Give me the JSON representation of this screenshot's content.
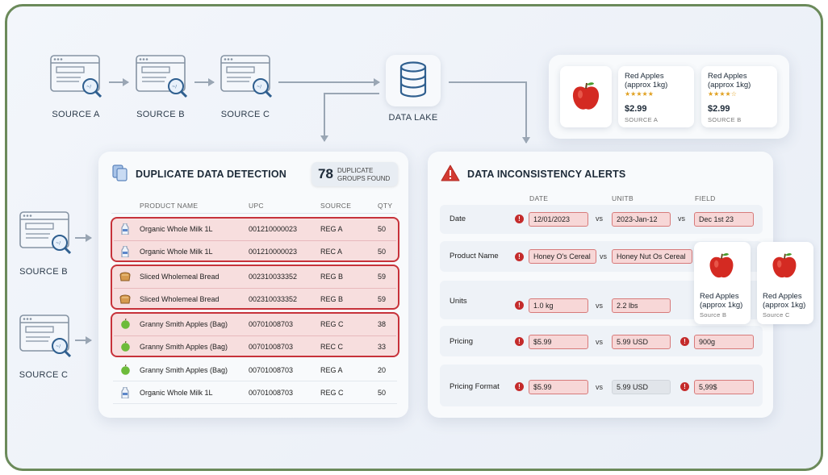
{
  "pipeline": {
    "sources_top": [
      "SOURCE A",
      "SOURCE B",
      "SOURCE C"
    ],
    "sources_left": [
      "SOURCE B",
      "SOURCE C"
    ],
    "data_lake_label": "DATA LAKE"
  },
  "product_panel": {
    "cards": [
      {
        "name_line1": "Red Apples",
        "name_line2": "(approx 1kg)",
        "stars": "★★★★★",
        "price": "$2.99",
        "source": "SOURCE A"
      },
      {
        "name_line1": "Red Apples",
        "name_line2": "(approx 1kg)",
        "stars": "★★★★☆",
        "price": "$2.99",
        "source": "SOURCE B"
      }
    ]
  },
  "floating_products": [
    {
      "name_line1": "Red Apples",
      "name_line2": "(approx 1kg)",
      "source": "Source B"
    },
    {
      "name_line1": "Red Apples",
      "name_line2": "(approx 1kg)",
      "source": "Source C"
    }
  ],
  "duplicate": {
    "title": "DUPLICATE DATA DETECTION",
    "count": "78",
    "count_label_1": "DUPLICATE",
    "count_label_2": "GROUPS FOUND",
    "columns": [
      "PRODUCT NAME",
      "UPC",
      "SOURCE",
      "QTY"
    ],
    "rows": [
      {
        "icon": "milk-icon",
        "name": "Organic Whole Milk 1L",
        "upc": "001210000023",
        "source": "REG A",
        "qty": "50"
      },
      {
        "icon": "milk-icon",
        "name": "Organic Whole Milk 1L",
        "upc": "001210000023",
        "source": "REC A",
        "qty": "50"
      },
      {
        "icon": "bread-icon",
        "name": "Sliced Wholemeal Bread",
        "upc": "002310033352",
        "source": "REG B",
        "qty": "59"
      },
      {
        "icon": "bread-icon",
        "name": "Sliced Wholemeal Bread",
        "upc": "002310033352",
        "source": "REG B",
        "qty": "59"
      },
      {
        "icon": "apple-icon",
        "name": "Granny Smith Apples (Bag)",
        "upc": "00701008703",
        "source": "REG C",
        "qty": "38"
      },
      {
        "icon": "apple-icon",
        "name": "Granny Smith Apples (Bag)",
        "upc": "00701008703",
        "source": "REC C",
        "qty": "33"
      },
      {
        "icon": "apple-icon",
        "name": "Granny Smith Apples (Bag)",
        "upc": "00701008703",
        "source": "REG A",
        "qty": "20"
      },
      {
        "icon": "milk-icon",
        "name": "Organic Whole Milk 1L",
        "upc": "00701008703",
        "source": "REG C",
        "qty": "50"
      }
    ]
  },
  "alerts": {
    "title": "DATA INCONSISTENCY ALERTS",
    "columns": [
      "DATE",
      "UNITB",
      "FIELD"
    ],
    "vs": "vs",
    "rows": [
      {
        "name": "Date",
        "v1": "12/01/2023",
        "v2": "2023-Jan-12",
        "v3": "Dec 1st 23"
      },
      {
        "name": "Product Name",
        "v1": "Honey O's Cereal",
        "v2": "Honey Nut Os Cereal"
      },
      {
        "name": "Units",
        "v1": "1.0 kg",
        "v2": "2.2 lbs"
      },
      {
        "name": "Pricing",
        "v1": "$5.99",
        "v2": "5.99 USD",
        "v3": "900g"
      },
      {
        "name": "Pricing Format",
        "v1": "$5.99",
        "v2": "5.99 USD",
        "v3": "5,99$"
      }
    ]
  },
  "colors": {
    "frame": "#6b8a5a",
    "alert_red": "#c42b2b",
    "group_border": "#c7323a"
  }
}
